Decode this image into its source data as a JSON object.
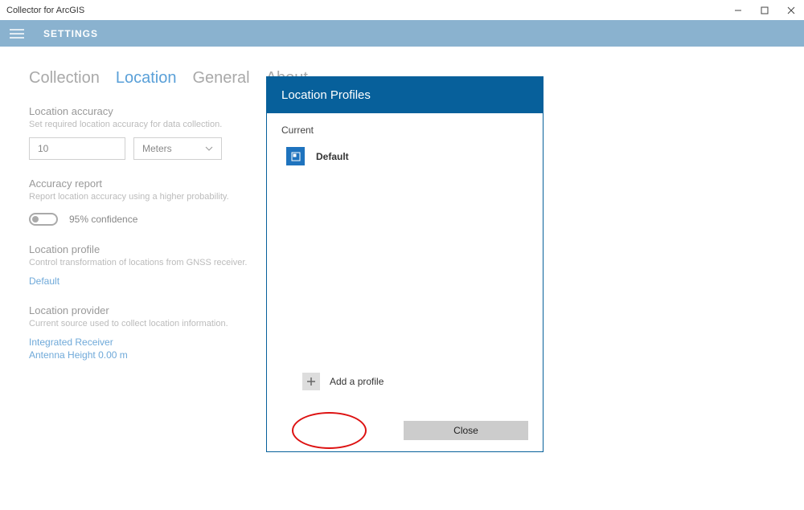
{
  "window": {
    "title": "Collector for ArcGIS"
  },
  "toolbar": {
    "title": "SETTINGS"
  },
  "tabs": [
    "Collection",
    "Location",
    "General",
    "About"
  ],
  "active_tab": 1,
  "accuracy": {
    "heading": "Location accuracy",
    "desc": "Set required location accuracy for data collection.",
    "value": "10",
    "unit": "Meters"
  },
  "report": {
    "heading": "Accuracy report",
    "desc": "Report location accuracy using a higher probability.",
    "toggle_label": "95% confidence"
  },
  "profile": {
    "heading": "Location profile",
    "desc": "Control transformation of locations from GNSS receiver.",
    "link": "Default"
  },
  "provider": {
    "heading": "Location provider",
    "desc": "Current source used to collect location information.",
    "link1": "Integrated Receiver",
    "link2": "Antenna Height 0.00 m"
  },
  "dialog": {
    "title": "Location Profiles",
    "current_label": "Current",
    "profile_name": "Default",
    "add_label": "Add a profile",
    "close_label": "Close"
  }
}
